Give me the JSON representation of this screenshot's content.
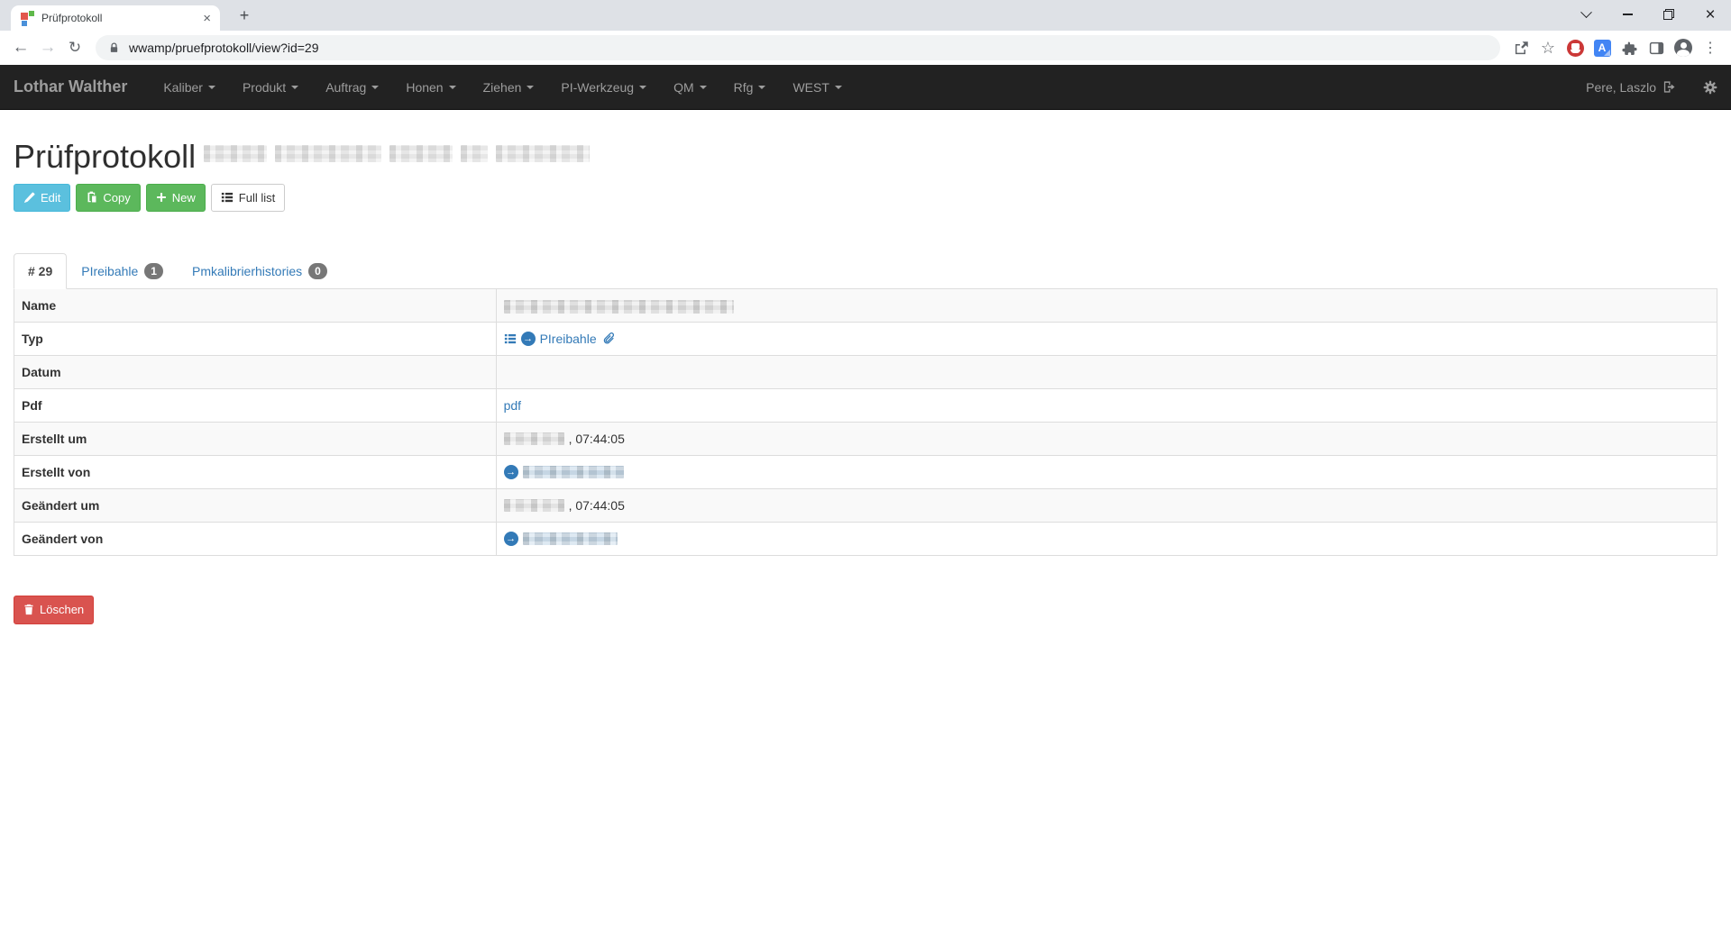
{
  "browser": {
    "tab_title": "Prüfprotokoll",
    "url": "wwamp/pruefprotokoll/view?id=29"
  },
  "navbar": {
    "brand": "Lothar Walther",
    "items": [
      {
        "label": "Kaliber"
      },
      {
        "label": "Produkt"
      },
      {
        "label": "Auftrag"
      },
      {
        "label": "Honen"
      },
      {
        "label": "Ziehen"
      },
      {
        "label": "PI-Werkzeug"
      },
      {
        "label": "QM"
      },
      {
        "label": "Rfg"
      },
      {
        "label": "WEST"
      }
    ],
    "user": "Pere, Laszlo"
  },
  "page": {
    "title": "Prüfprotokoll",
    "actions": {
      "edit": "Edit",
      "copy": "Copy",
      "new": "New",
      "full_list": "Full list",
      "delete": "Löschen"
    },
    "tabs": [
      {
        "label": "# 29"
      },
      {
        "label": "PIreibahle",
        "badge": "1"
      },
      {
        "label": "Pmkalibrierhistories",
        "badge": "0"
      }
    ],
    "details": {
      "rows": [
        {
          "label": "Name"
        },
        {
          "label": "Typ",
          "link": "PIreibahle"
        },
        {
          "label": "Datum"
        },
        {
          "label": "Pdf",
          "link": "pdf"
        },
        {
          "label": "Erstellt um",
          "time": ", 07:44:05"
        },
        {
          "label": "Erstellt von"
        },
        {
          "label": "Geändert um",
          "time": ", 07:44:05"
        },
        {
          "label": "Geändert von"
        }
      ]
    }
  },
  "colors": {
    "link": "#337ab7",
    "info_button": "#5bc0de",
    "success_button": "#5cb85c",
    "danger_button": "#d9534f",
    "navbar_bg": "#222222",
    "navbar_text": "#9d9d9d",
    "table_stripe": "#f9f9f9"
  }
}
